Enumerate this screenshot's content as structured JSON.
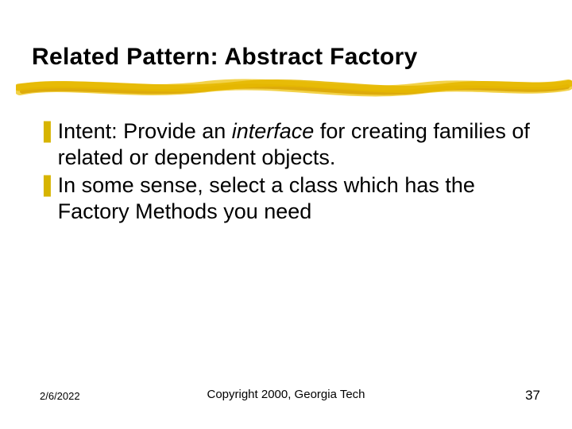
{
  "title": "Related Pattern: Abstract Factory",
  "bullets": [
    {
      "pre": "Intent: Provide an ",
      "italic": "interface",
      "post": " for creating families of related or dependent objects."
    },
    {
      "pre": "In some sense, select a class which has the Factory Methods you need",
      "italic": "",
      "post": ""
    }
  ],
  "bullet_glyph": "❚",
  "footer": {
    "date": "2/6/2022",
    "copyright": "Copyright 2000, Georgia Tech",
    "page": "37"
  },
  "colors": {
    "accent": "#e6b800",
    "underline_light": "#f2d24a",
    "underline_dark": "#d9a400"
  }
}
